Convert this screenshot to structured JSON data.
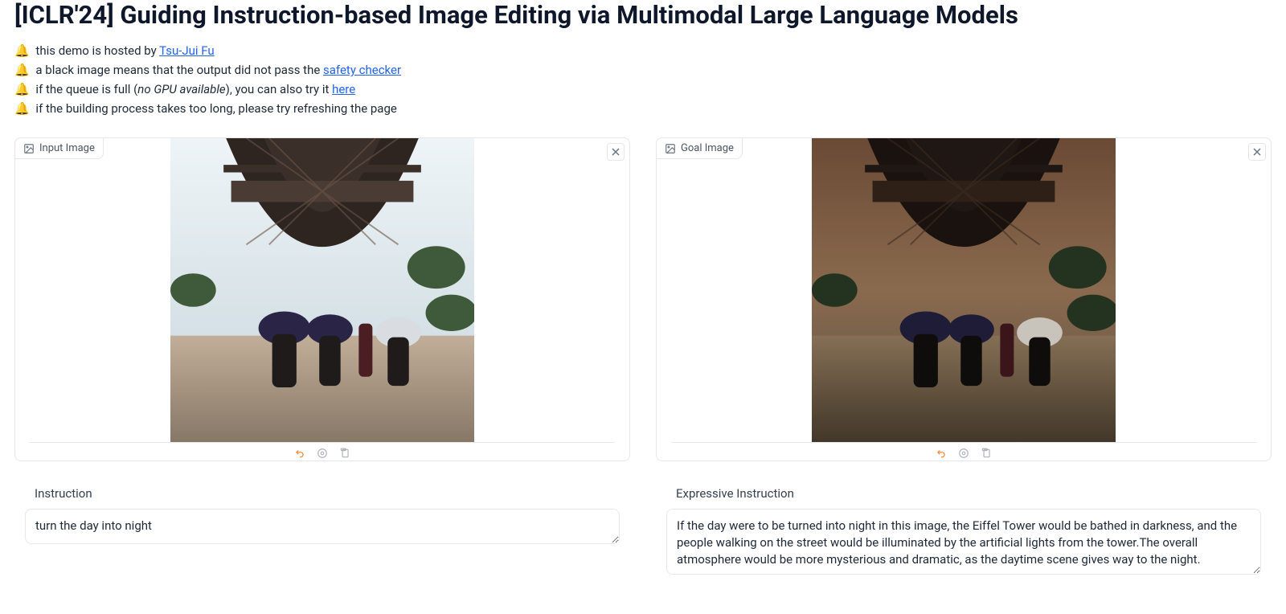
{
  "title": "[ICLR'24] Guiding Instruction-based Image Editing via Multimodal Large Language Models",
  "intro": {
    "bell": "🔔",
    "line1_prefix": "this demo is hosted by ",
    "line1_link": "Tsu-Jui Fu",
    "line2_prefix": "a black image means that the output did not pass the ",
    "line2_link": "safety checker",
    "line3_prefix": "if the queue is full (",
    "line3_em": "no GPU available",
    "line3_mid": "), you can also try it ",
    "line3_link": "here",
    "line4": "if the building process takes too long, please try refreshing the page"
  },
  "panels": {
    "input_image": {
      "label": "Input Image"
    },
    "goal_image": {
      "label": "Goal Image"
    }
  },
  "instruction": {
    "label": "Instruction",
    "value": "turn the day into night"
  },
  "expressive": {
    "label": "Expressive Instruction",
    "value": "If the day were to be turned into night in this image, the Eiffel Tower would be bathed in darkness, and the people walking on the street would be illuminated by the artificial lights from the tower.The overall atmosphere would be more mysterious and dramatic, as the daytime scene gives way to the night."
  }
}
